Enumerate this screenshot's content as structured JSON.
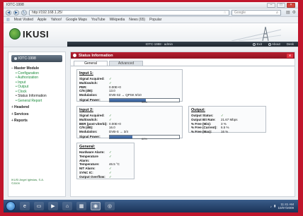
{
  "browser": {
    "title": "IOTC-1998",
    "url": "http://192.168.1.25/",
    "search_placeholder": "Google",
    "bookmarks": [
      "Most Visited",
      "Apple",
      "Yahoo!",
      "Google Maps",
      "YouTube",
      "Wikipedia",
      "News (65)",
      "Popular"
    ]
  },
  "header": {
    "brand": "IKUSI",
    "device_label": "IOTC-1998 · admin",
    "buttons": [
      "Exit",
      "About",
      "Desk"
    ]
  },
  "sidebar": {
    "device": "IOTC-1998",
    "menu": [
      {
        "type": "section",
        "label": "Master Module",
        "sign": "−"
      },
      {
        "type": "sub",
        "label": "Configuration"
      },
      {
        "type": "sub",
        "label": "Authorization"
      },
      {
        "type": "sub",
        "label": "Input"
      },
      {
        "type": "sub",
        "label": "Output"
      },
      {
        "type": "sub",
        "label": "Clock"
      },
      {
        "type": "sub",
        "label": "Status Information",
        "active": true
      },
      {
        "type": "sub",
        "label": "General Report"
      },
      {
        "type": "section",
        "label": "Headend",
        "sign": "+"
      },
      {
        "type": "section",
        "label": "Services",
        "sign": "+"
      },
      {
        "type": "section",
        "label": "Reports",
        "sign": "+"
      }
    ],
    "copyright": [
      "IKUSI Angel Iglesias, S.A.",
      "©2009"
    ]
  },
  "panel": {
    "title": "Status Information",
    "tabs": [
      "General",
      "Advanced"
    ],
    "input1": {
      "title": "Input 1:",
      "rows": [
        {
          "k": "Signal Acquired:",
          "v": "✓"
        },
        {
          "k": "Multiswitch:",
          "v": "✓"
        },
        {
          "k": "PER:",
          "v": "0.00E+0"
        },
        {
          "k": "C/N (dB):",
          "v": "13.0"
        },
        {
          "k": "Modulation:",
          "v": "DVB-S2 → QPSK 9/10"
        }
      ],
      "power_label": "Signal Power:",
      "power_pct": 95,
      "power_text": "95%"
    },
    "input2": {
      "title": "Input 2:",
      "rows": [
        {
          "k": "Signal Acquired:",
          "v": "✓"
        },
        {
          "k": "Multiswitch:",
          "v": "✓"
        },
        {
          "k": "BER (post-viterbi):",
          "v": "0.00E+0"
        },
        {
          "k": "C/N (dB):",
          "v": "16.0"
        },
        {
          "k": "Modulation:",
          "v": "DVB-S → 3/4"
        }
      ],
      "power_label": "Signal Power:",
      "power_pct": 60,
      "power_text": "60%"
    },
    "output": {
      "title": "Output:",
      "rows": [
        {
          "k": "Output Status:",
          "v": "✓"
        },
        {
          "k": "Output Bit Rate:",
          "v": "21.67 Mbps"
        },
        {
          "k": "% Free (Min):",
          "v": "3 %"
        },
        {
          "k": "% Free (Current):",
          "v": "6.5 %"
        },
        {
          "k": "% Free (Max):",
          "v": "16 %"
        }
      ]
    },
    "general": {
      "title": "General:",
      "rows": [
        {
          "k": "Hardware Alarm:",
          "v": "✓"
        },
        {
          "k": "Temperature Alarm:",
          "v": "✓"
        },
        {
          "k": "Temperature:",
          "v": "46.5 °C"
        },
        {
          "k": "NIT Alarm:",
          "v": "✓"
        },
        {
          "k": "SYNC IC:",
          "v": "✓"
        },
        {
          "k": "Output Overflow:",
          "v": "✓"
        }
      ]
    }
  },
  "taskbar": {
    "time": "11:41 AM",
    "date": "10/07/2009"
  }
}
